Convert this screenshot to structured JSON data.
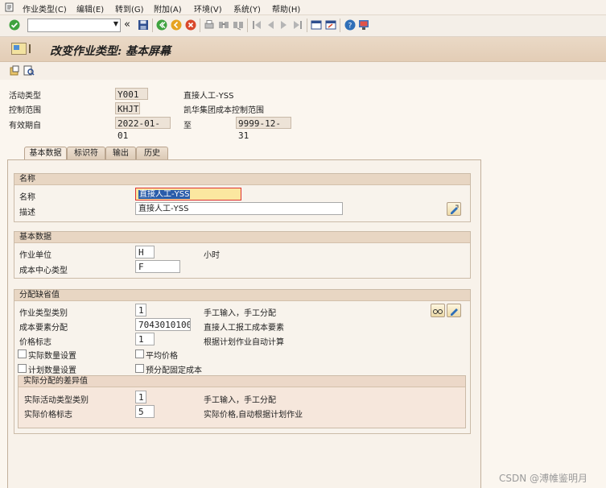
{
  "menu": {
    "items": [
      "作业类型(C)",
      "编辑(E)",
      "转到(G)",
      "附加(A)",
      "环境(V)",
      "系统(Y)",
      "帮助(H)"
    ]
  },
  "toolbar": {
    "command_value": "",
    "icons": [
      "enter-icon",
      "back-icon",
      "exit-icon",
      "cancel-icon",
      "print-icon",
      "find-icon",
      "find-next-icon",
      "first-page-icon",
      "prev-page-icon",
      "next-page-icon",
      "last-page-icon",
      "new-session-icon",
      "shortcut-icon",
      "help-icon",
      "layout-icon"
    ],
    "accent_green": "#3fa33f",
    "accent_red": "#d9482b",
    "accent_yellow": "#e6a320"
  },
  "title": "改变作业类型: 基本屏幕",
  "header": {
    "activity_type_label": "活动类型",
    "activity_type_value": "Y001",
    "activity_type_desc": "直接人工-YSS",
    "controlling_area_label": "控制范围",
    "controlling_area_value": "KHJT",
    "controlling_area_desc": "凯华集团成本控制范围",
    "valid_from_label": "有效期自",
    "valid_from_value": "2022-01-01",
    "to_label": "至",
    "valid_to_value": "9999-12-31"
  },
  "tabs": [
    "基本数据",
    "标识符",
    "输出",
    "历史"
  ],
  "names_group": {
    "title": "名称",
    "name_label": "名称",
    "name_value": "直接人工-YSS",
    "desc_label": "描述",
    "desc_value": "直接人工-YSS"
  },
  "basic_group": {
    "title": "基本数据",
    "unit_label": "作业单位",
    "unit_value": "H",
    "unit_desc": "小时",
    "cc_category_label": "成本中心类型",
    "cc_category_value": "F"
  },
  "defaults_group": {
    "title": "分配缺省值",
    "atype_cat_label": "作业类型类别",
    "atype_cat_value": "1",
    "atype_cat_desc": "手工输入，手工分配",
    "cost_elem_label": "成本要素分配",
    "cost_elem_value": "7043010100",
    "cost_elem_desc": "直接人工报工成本要素",
    "price_ind_label": "价格标志",
    "price_ind_value": "1",
    "price_ind_desc": "根据计划作业自动计算",
    "actual_qty_label": "实际数量设置",
    "avg_price_label": "平均价格",
    "plan_qty_label": "计划数量设置",
    "predist_fixed_label": "预分配固定成本"
  },
  "variance_group": {
    "title": "实际分配的差异值",
    "actual_cat_label": "实际活动类型类别",
    "actual_cat_value": "1",
    "actual_cat_desc": "手工输入，手工分配",
    "actual_price_label": "实际价格标志",
    "actual_price_value": "5",
    "actual_price_desc": "实际价格,自动根据计划作业"
  },
  "watermark": "CSDN @溥帷鉴明月"
}
